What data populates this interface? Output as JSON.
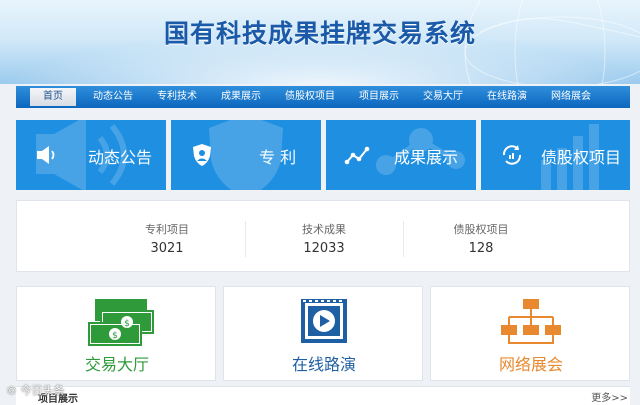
{
  "header": {
    "title": "国有科技成果挂牌交易系统"
  },
  "nav": {
    "items": [
      {
        "label": "首页",
        "active": true
      },
      {
        "label": "动态公告"
      },
      {
        "label": "专利技术"
      },
      {
        "label": "成果展示"
      },
      {
        "label": "债股权项目"
      },
      {
        "label": "项目展示"
      },
      {
        "label": "交易大厅"
      },
      {
        "label": "在线路演"
      },
      {
        "label": "网络展会"
      }
    ]
  },
  "tiles": [
    {
      "label": "动态公告",
      "icon": "speaker-icon"
    },
    {
      "label": "专 利",
      "icon": "shield-user-icon"
    },
    {
      "label": "成果展示",
      "icon": "line-chart-icon"
    },
    {
      "label": "债股权项目",
      "icon": "refresh-chart-icon"
    }
  ],
  "stats": [
    {
      "label": "专利项目",
      "value": "3021"
    },
    {
      "label": "技术成果",
      "value": "12033"
    },
    {
      "label": "债股权项目",
      "value": "128"
    }
  ],
  "cards": [
    {
      "label": "交易大厅",
      "icon": "money-icon",
      "color": "#2e9a3a"
    },
    {
      "label": "在线路演",
      "icon": "video-play-icon",
      "color": "#1f5fa3"
    },
    {
      "label": "网络展会",
      "icon": "network-icon",
      "color": "#e8892f"
    }
  ],
  "bottom": {
    "section_title": "项目展示",
    "more_label": "更多>>"
  },
  "watermark": "© 今日头条"
}
